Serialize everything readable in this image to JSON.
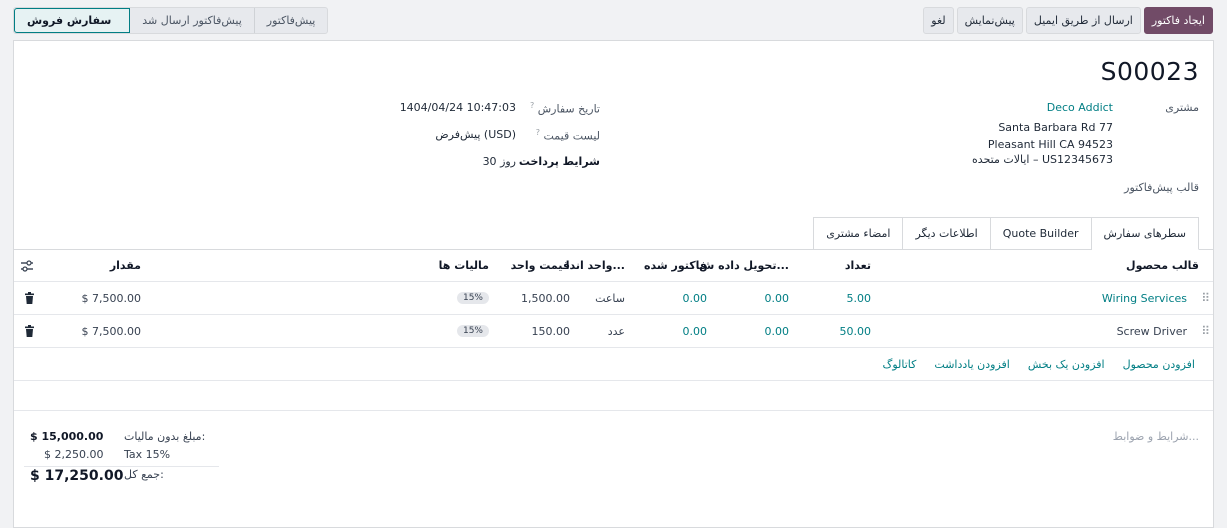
{
  "actions": {
    "create_invoice": "ایجاد فاکتور",
    "send_email": "ارسال از طریق ایمیل",
    "preview": "پیش‌نمایش",
    "cancel": "لغو"
  },
  "stages": [
    "سفارش فروش",
    "پیش‌فاکتور ارسال شد",
    "پیش‌فاکتور"
  ],
  "order": {
    "number": "S00023",
    "customer_label": "مشتری",
    "customer_name": "Deco Addict",
    "address_line1": "Santa Barbara Rd 77",
    "address_line2": "Pleasant Hill CA 94523",
    "address_line3": "ایالات متحده – US12345673",
    "template_label": "قالب پیش‌فاکتور",
    "order_date_label": "تاریخ سفارش",
    "order_date": "1404/04/24 10:47:03",
    "pricelist_label": "لیست قیمت",
    "pricelist": "پیش‌فرض (USD)",
    "payment_terms_label": "شرایط پرداخت",
    "payment_terms": "30 روز"
  },
  "tabs": [
    "سطرهای سفارش",
    "Quote Builder",
    "اطلاعات دیگر",
    "امضاء مشتری"
  ],
  "table": {
    "headers": {
      "product": "قالب محصول",
      "qty": "تعداد",
      "delivered": "تحویل داده ش...",
      "invoiced": "فاکتور شده",
      "uom": "واحد اندا...",
      "price": "قیمت واحد",
      "taxes": "مالیات ها",
      "amount": "مقدار"
    },
    "rows": [
      {
        "product": "Wiring Services",
        "qty": "5.00",
        "delivered": "0.00",
        "invoiced": "0.00",
        "uom": "ساعت",
        "price": "1,500.00",
        "tax": "15%",
        "amount": "$ 7,500.00"
      },
      {
        "product": "Screw Driver",
        "qty": "50.00",
        "delivered": "0.00",
        "invoiced": "0.00",
        "uom": "عدد",
        "price": "150.00",
        "tax": "15%",
        "amount": "$ 7,500.00"
      }
    ]
  },
  "add_links": {
    "add_product": "افزودن محصول",
    "add_section": "افزودن یک بخش",
    "add_note": "افزودن یادداشت",
    "catalog": "کاتالوگ"
  },
  "terms_placeholder": "شرایط و ضوابط...",
  "totals": {
    "untaxed_label": "مبلغ بدون مالیات:",
    "untaxed": "$ 15,000.00",
    "tax_label": "Tax 15%",
    "tax": "$ 2,250.00",
    "total_label": "جمع کل:",
    "total": "$ 17,250.00"
  },
  "colors": {
    "primary": "#714b67",
    "link": "#017e84"
  }
}
